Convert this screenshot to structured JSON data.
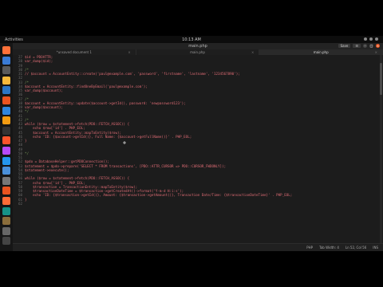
{
  "topbar": {
    "activities": "Activities",
    "clock": "10:13 AM"
  },
  "header": {
    "title": "main.php",
    "save_label": "Save"
  },
  "tabs": [
    {
      "label": "*unsaved document 1"
    },
    {
      "label": "main.php"
    },
    {
      "label": "main.php"
    }
  ],
  "code_lines": [
    {
      "n": "27",
      "t": "$id = PDOATTR;",
      "cls": "txt"
    },
    {
      "n": "28",
      "t": "var_dump($id);",
      "cls": "txt"
    },
    {
      "n": "29",
      "t": "",
      "cls": "txt"
    },
    {
      "n": "30",
      "t": "/*",
      "cls": "cm"
    },
    {
      "n": "31",
      "t": "// $account = AccountEntity::create('paul@example.com', 'password', 'firstname', 'lastname', '1234567890');",
      "cls": "txt"
    },
    {
      "n": "32",
      "t": "",
      "cls": "txt"
    },
    {
      "n": "33",
      "t": "/*",
      "cls": "cm"
    },
    {
      "n": "34",
      "t": "$account = AccountEntity::findOneByEmail('paul@example.com');",
      "cls": "txt"
    },
    {
      "n": "35",
      "t": "var_dump($account);",
      "cls": "txt"
    },
    {
      "n": "36",
      "t": "",
      "cls": "txt"
    },
    {
      "n": "37",
      "t": "/*",
      "cls": "cm"
    },
    {
      "n": "38",
      "t": "$account = AccountEntity::update($account->getId(), password: 'newpassword123');",
      "cls": "txt"
    },
    {
      "n": "39",
      "t": "var_dump($account);",
      "cls": "txt"
    },
    {
      "n": "40",
      "t": "*/",
      "cls": "cm"
    },
    {
      "n": "41",
      "t": "",
      "cls": "txt"
    },
    {
      "n": "42",
      "t": "/*",
      "cls": "cm"
    },
    {
      "n": "43",
      "t": "while ($row = $statement->fetch(PDO::FETCH_ASSOC)) {",
      "cls": "txt"
    },
    {
      "n": "44",
      "t": "    echo $row['id'] . PHP_EOL;",
      "cls": "txt"
    },
    {
      "n": "45",
      "t": "    $account = AccountEntity::mapToEntity($row);",
      "cls": "txt"
    },
    {
      "n": "46",
      "t": "    echo 'ID: {$account->getId()}, Full Name: {$account->getFullName()}' . PHP_EOL;",
      "cls": "txt"
    },
    {
      "n": "47",
      "t": "}",
      "cls": "txt"
    },
    {
      "n": "48",
      "t": "",
      "cls": "txt"
    },
    {
      "n": "49",
      "t": "",
      "cls": "txt"
    },
    {
      "n": "50",
      "t": "*/",
      "cls": "cm"
    },
    {
      "n": "51",
      "t": "",
      "cls": "txt"
    },
    {
      "n": "52",
      "t": "$pdo = DatabaseHelper::getPDOConnection();",
      "cls": "txt"
    },
    {
      "n": "53",
      "t": "$statement = $pdo->prepare('SELECT * FROM transactions', [PDO::ATTR_CURSOR => PDO::CURSOR_FWDONLY]);",
      "cls": "txt"
    },
    {
      "n": "54",
      "t": "$statement->execute();",
      "cls": "txt"
    },
    {
      "n": "55",
      "t": "",
      "cls": "txt"
    },
    {
      "n": "56",
      "t": "while ($row = $statement->fetch(PDO::FETCH_ASSOC)) {",
      "cls": "txt"
    },
    {
      "n": "57",
      "t": "    echo $row['id'] . PHP_EOL;",
      "cls": "txt"
    },
    {
      "n": "58",
      "t": "    $transaction = TransactionEntity::mapToEntity($row);",
      "cls": "txt"
    },
    {
      "n": "59",
      "t": "    $transactionDateTime = $transaction->getCreatedAt()->format('Y-m-d H:i:s');",
      "cls": "txt"
    },
    {
      "n": "60",
      "t": "    echo 'ID: {$transaction->getId()}, Amount: {$transaction->getAmount()}, Transaction Date/Time: {$transactionDateTime}' . PHP_EOL;",
      "cls": "txt"
    },
    {
      "n": "61",
      "t": "}",
      "cls": "txt"
    },
    {
      "n": "62",
      "t": "",
      "cls": "txt"
    }
  ],
  "status": {
    "lang": "PHP",
    "tab_width": "Tab Width: 4",
    "position": "Ln 52, Col 56",
    "mode": "INS"
  },
  "colors": {
    "code_text": "#e06c75",
    "comment": "#7a9a5a",
    "accent": "#e95420"
  },
  "dock_icons": [
    {
      "name": "firefox-icon",
      "color": "#ff7139"
    },
    {
      "name": "thunderbird-icon",
      "color": "#3a7bd5"
    },
    {
      "name": "files-icon",
      "color": "#5a5a5a"
    },
    {
      "name": "rhythmbox-icon",
      "color": "#f6b93b"
    },
    {
      "name": "libreoffice-writer-icon",
      "color": "#2a76c6"
    },
    {
      "name": "software-icon",
      "color": "#e95420"
    },
    {
      "name": "help-icon",
      "color": "#2e86de"
    },
    {
      "name": "vlc-icon",
      "color": "#f39c12"
    },
    {
      "name": "terminal-icon",
      "color": "#333333"
    },
    {
      "name": "brave-icon",
      "color": "#fb542b"
    },
    {
      "name": "phpstorm-icon",
      "color": "#b74af7"
    },
    {
      "name": "vscode-icon",
      "color": "#2496ed"
    },
    {
      "name": "text-editor-icon",
      "color": "#4a90d9"
    },
    {
      "name": "settings-icon",
      "color": "#777777"
    },
    {
      "name": "app-icon",
      "color": "#e95420"
    },
    {
      "name": "postman-icon",
      "color": "#ff6c37"
    },
    {
      "name": "gitkraken-icon",
      "color": "#179287"
    },
    {
      "name": "gimp-icon",
      "color": "#8a6d3b"
    },
    {
      "name": "trash-icon",
      "color": "#666666"
    },
    {
      "name": "show-apps-icon",
      "color": "#444444"
    }
  ]
}
